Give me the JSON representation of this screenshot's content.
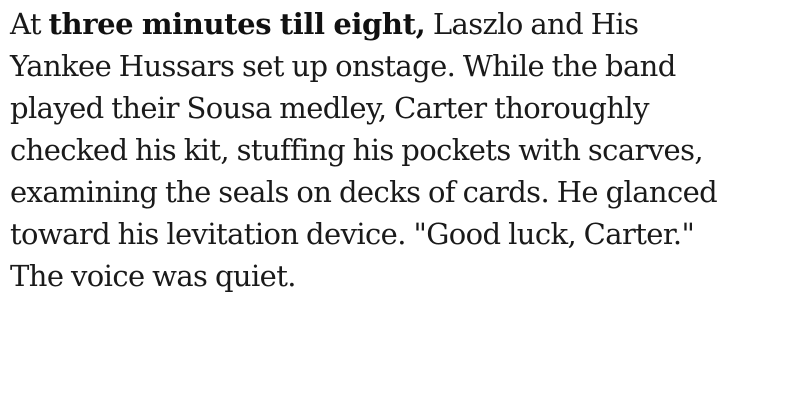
{
  "passage": {
    "lead_before": "At ",
    "lead_bold": "three minutes till eight,",
    "lines": [
      " Laszlo and His",
      "Yankee Hussars set up onstage. While the band",
      "played their Sousa medley, Carter thoroughly",
      "checked his kit, stuffing his pockets with scarves,",
      "examining the seals on decks of cards. He glanced",
      "toward his levitation device. \"Good luck, Carter.\"",
      "The voice was quiet."
    ]
  }
}
